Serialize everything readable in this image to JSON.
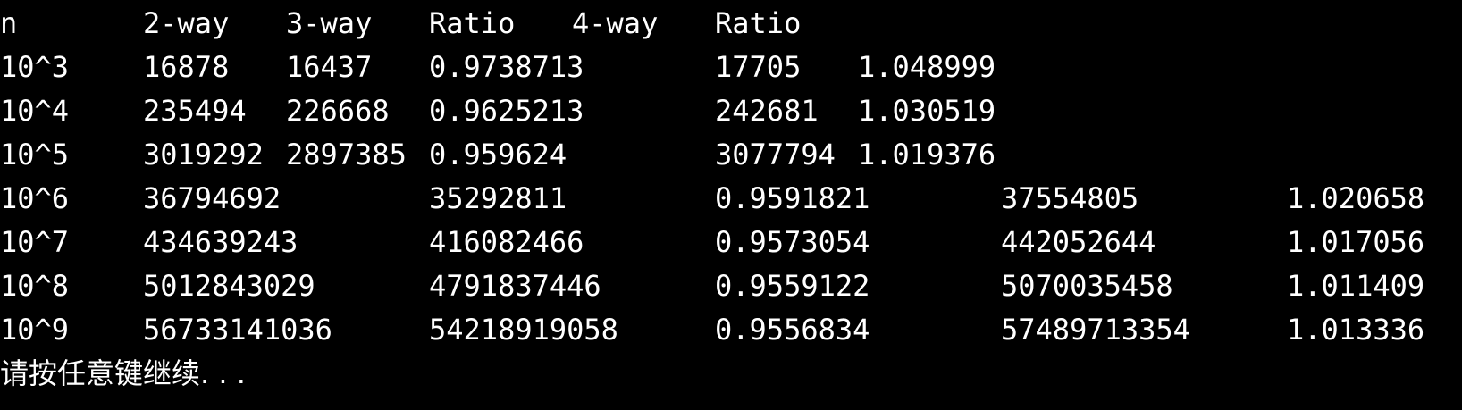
{
  "console": {
    "background": "#000000",
    "foreground": "#ffffff",
    "header": [
      "n",
      "2-way",
      "3-way",
      "Ratio",
      "4-way",
      "Ratio"
    ],
    "rows_short": [
      [
        "10^3",
        "16878",
        "16437",
        "0.9738713",
        "17705",
        "1.048999"
      ],
      [
        "10^4",
        "235494",
        "226668",
        "0.9625213",
        "242681",
        "1.030519"
      ],
      [
        "10^5",
        "3019292",
        "2897385",
        "0.959624",
        "3077794",
        "1.019376"
      ]
    ],
    "rows_wide": [
      [
        "10^6",
        "36794692",
        "35292811",
        "0.9591821",
        "37554805",
        "1.020658"
      ],
      [
        "10^7",
        "434639243",
        "416082466",
        "0.9573054",
        "442052644",
        "1.017056"
      ],
      [
        "10^8",
        "5012843029",
        "4791837446",
        "0.9559122",
        "5070035458",
        "1.011409"
      ],
      [
        "10^9",
        "56733141036",
        "54218919058",
        "0.9556834",
        "57489713354",
        "1.013336"
      ]
    ],
    "prompt": "请按任意键继续. . ."
  }
}
